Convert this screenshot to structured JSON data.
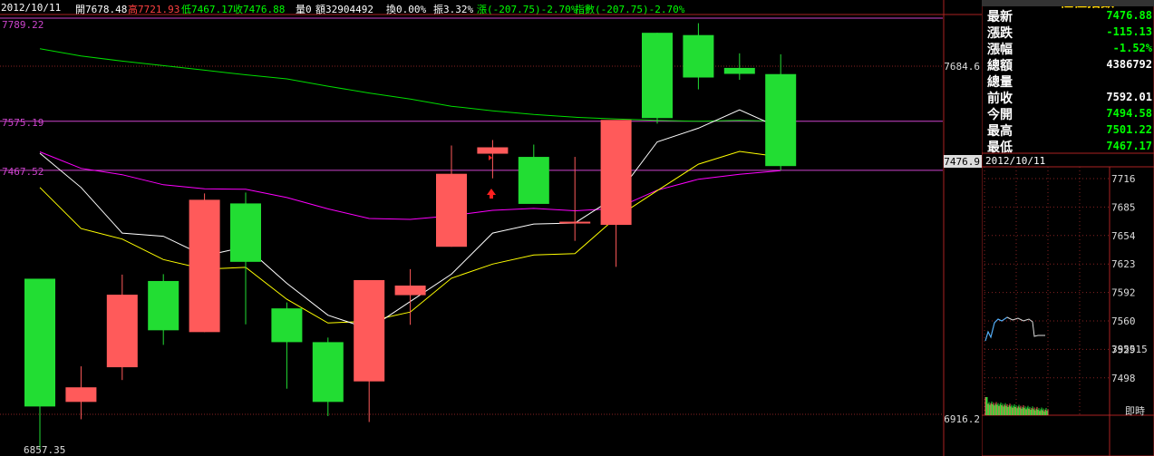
{
  "header": {
    "date": "2012/10/11",
    "open_label": "開7678.48",
    "high_label": "高7721.93",
    "low_label": "低7467.17",
    "close_label": "收7476.88",
    "vol_label": "量0",
    "amount_label": "額32904492",
    "turnover_label": "換0.00%",
    "amp_label": "振3.32%",
    "change_label": "漲(-207.75)-2.70%",
    "index_label": "指數(-207.75)-2.70%",
    "colors": {
      "up": "#ff3030",
      "down": "#00ff00",
      "neutral": "#ffffff",
      "accent": "#ffff00"
    }
  },
  "main_axis": {
    "left_labels": [
      "7789.22",
      "7575.19",
      "7467.52",
      "6857.35"
    ],
    "right_labels": [
      "7684.6",
      "7476.9",
      "6916.2"
    ]
  },
  "quote": {
    "title": "櫃檯指數",
    "rows": [
      {
        "label": "最新",
        "value": "7476.88",
        "color": "#00ff00"
      },
      {
        "label": "漲跌",
        "value": "-115.13",
        "color": "#00ff00"
      },
      {
        "label": "漲幅",
        "value": "-1.52%",
        "color": "#00ff00"
      },
      {
        "label": "總額",
        "value": "4386792",
        "color": "#ffffff"
      },
      {
        "label": "總量",
        "value": "",
        "color": "#ffffff"
      },
      {
        "label": "前收",
        "value": "7592.01",
        "color": "#ffffff"
      },
      {
        "label": "今開",
        "value": "7494.58",
        "color": "#00ff00"
      },
      {
        "label": "最高",
        "value": "7501.22",
        "color": "#00ff00"
      },
      {
        "label": "最低",
        "value": "7467.17",
        "color": "#00ff00"
      }
    ],
    "date": "2012/10/11"
  },
  "intraday": {
    "axis_labels": [
      "7716",
      "7685",
      "7654",
      "7623",
      "7592",
      "7560",
      "7529",
      "7498",
      "395515"
    ],
    "label": "即時"
  },
  "chart_data": {
    "type": "candlestick",
    "ylim": [
      6857.35,
      7789.22
    ],
    "reference_lines": [
      7789.22,
      7575.19,
      7467.52
    ],
    "candles": [
      {
        "o": 7230,
        "h": 7230,
        "l": 6857,
        "c": 6950
      },
      {
        "o": 6960,
        "h": 7038,
        "l": 6922,
        "c": 6992
      },
      {
        "o": 7036,
        "h": 7239,
        "l": 7008,
        "c": 7195
      },
      {
        "o": 7225,
        "h": 7240,
        "l": 7085,
        "c": 7117
      },
      {
        "o": 7113,
        "h": 7417,
        "l": 7113,
        "c": 7403
      },
      {
        "o": 7395,
        "h": 7419,
        "l": 7130,
        "c": 7267
      },
      {
        "o": 7165,
        "h": 7178,
        "l": 6989,
        "c": 7091
      },
      {
        "o": 7091,
        "h": 7101,
        "l": 6929,
        "c": 6960
      },
      {
        "o": 7005,
        "h": 7227,
        "l": 6916,
        "c": 7227
      },
      {
        "o": 7194,
        "h": 7251,
        "l": 7129,
        "c": 7215
      },
      {
        "o": 7300,
        "h": 7522,
        "l": 7300,
        "c": 7460
      },
      {
        "o": 7504,
        "h": 7534,
        "l": 7450,
        "c": 7518
      },
      {
        "o": 7497,
        "h": 7524,
        "l": 7472,
        "c": 7394
      },
      {
        "o": 7351,
        "h": 7497,
        "l": 7313,
        "c": 7355
      },
      {
        "o": 7348,
        "h": 7497,
        "l": 7256,
        "c": 7578
      },
      {
        "o": 7769,
        "h": 7769,
        "l": 7570,
        "c": 7582
      },
      {
        "o": 7764,
        "h": 7790,
        "l": 7645,
        "c": 7671
      },
      {
        "o": 7692,
        "h": 7724,
        "l": 7666,
        "c": 7679
      },
      {
        "o": 7678.48,
        "h": 7721.93,
        "l": 7467.17,
        "c": 7476.88
      }
    ],
    "ma_series": [
      {
        "color": "#00dd00",
        "values": [
          7734,
          7718,
          7707,
          7697,
          7687,
          7677,
          7668,
          7652,
          7637,
          7624,
          7608,
          7598,
          7590,
          7584,
          7580,
          7577,
          7575,
          7577,
          7575
        ]
      },
      {
        "color": "#ff00ff",
        "values": [
          7508,
          7472,
          7458,
          7436,
          7427,
          7426,
          7408,
          7383,
          7362,
          7360,
          7368,
          7380,
          7384,
          7379,
          7384,
          7424,
          7448,
          7459,
          7467
        ]
      },
      {
        "color": "#ffff00",
        "values": [
          7430,
          7340,
          7317,
          7272,
          7251,
          7255,
          7185,
          7133,
          7137,
          7157,
          7231,
          7262,
          7282,
          7285,
          7364,
          7423,
          7481,
          7509,
          7497
        ]
      },
      {
        "color": "#ffffff",
        "values": null
      }
    ]
  }
}
